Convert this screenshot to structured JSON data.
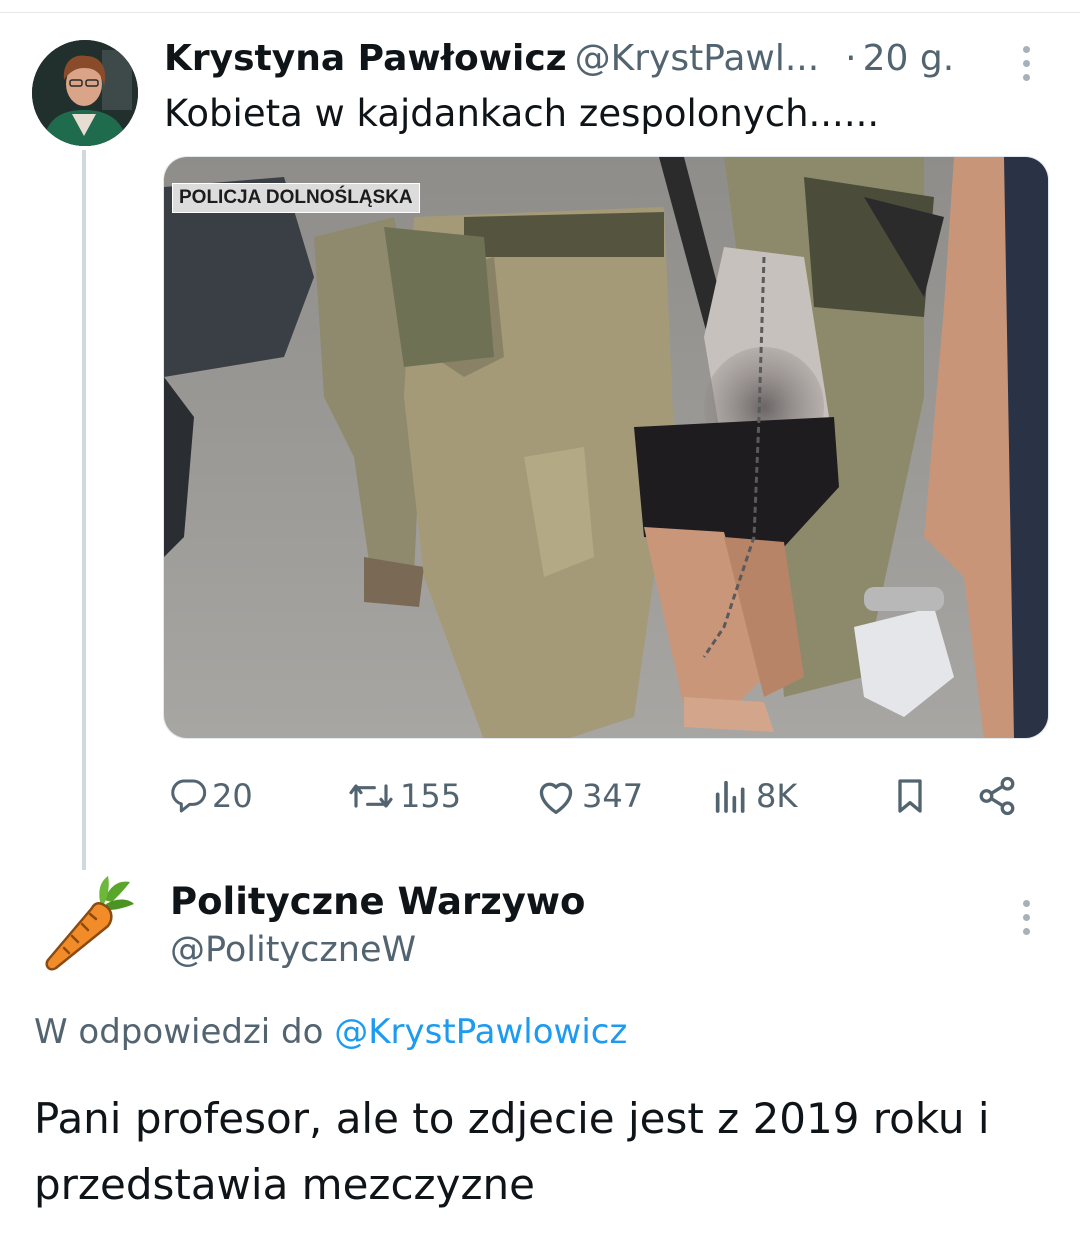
{
  "tweet": {
    "author_name": "Krystyna Pawłowicz",
    "author_handle": "@KrystPawl...",
    "dot": "·",
    "time": "20 g.",
    "text": "Kobieta w kajdankach zespolonych......",
    "media_caption": "POLICJA DOLNOŚLĄSKA",
    "media_icon": "photo-arrest-scene",
    "replies": "20",
    "retweets": "155",
    "likes": "347",
    "views": "8K"
  },
  "reply": {
    "author_name": "Polityczne Warzywo",
    "author_handle": "@PolityczneW",
    "avatar_icon": "carrot-icon",
    "reply_prefix": "W odpowiedzi do",
    "reply_mention": "@KrystPawlowicz",
    "text": "Pani profesor, ale to zdjecie jest z 2019 roku i przedstawia mezczyzne"
  },
  "colors": {
    "text": "#0f1419",
    "secondary": "#536471",
    "link": "#1d9bf0",
    "thread_line": "#cfd9de"
  }
}
